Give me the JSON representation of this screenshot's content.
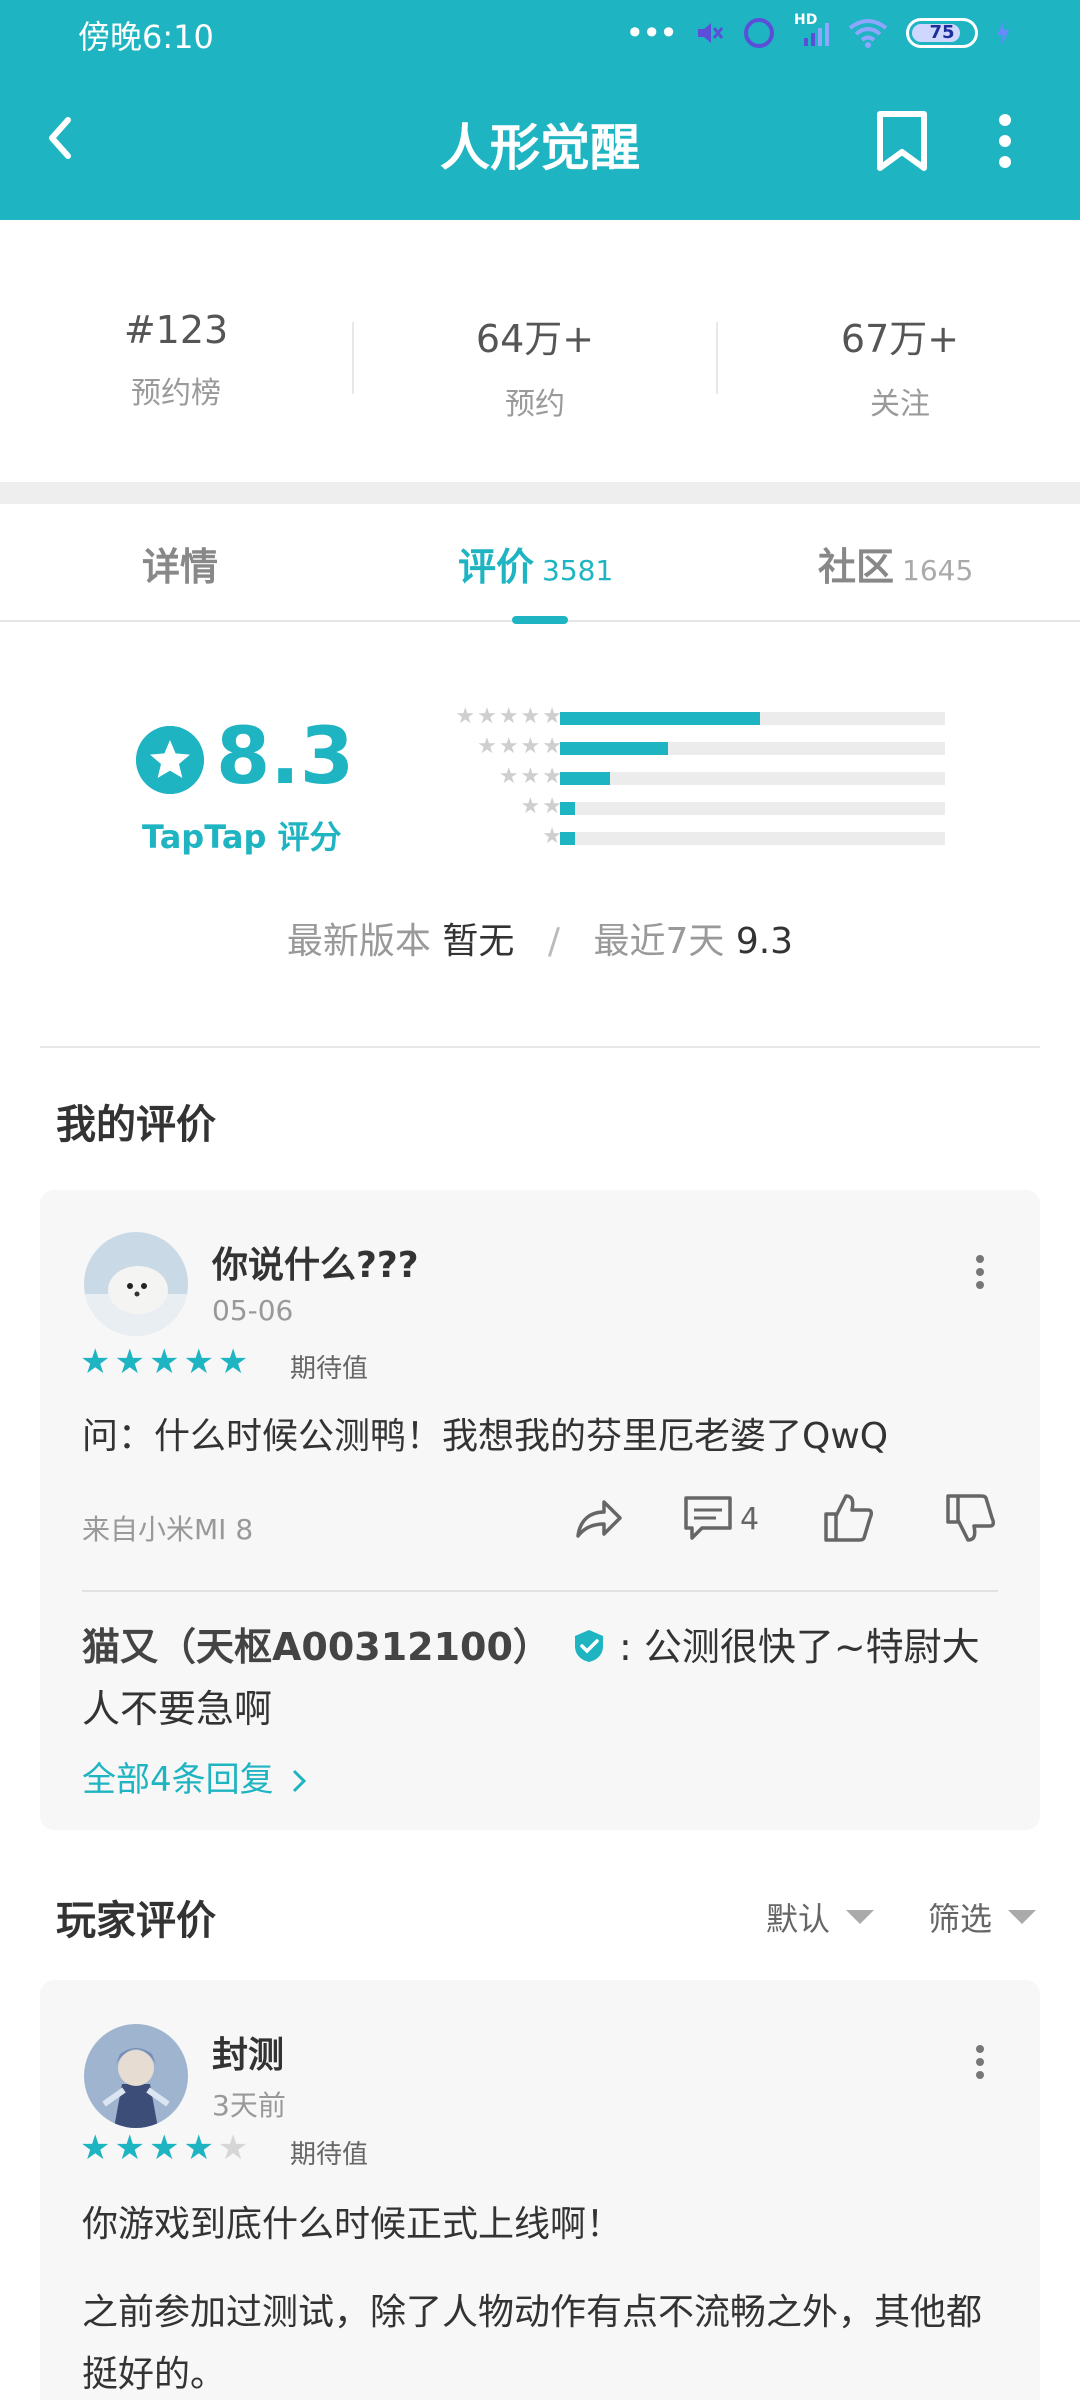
{
  "status_bar": {
    "time": "傍晚6:10",
    "dots": "•••",
    "battery": "75",
    "hd": "HD"
  },
  "header": {
    "title": "人形觉醒"
  },
  "stats": [
    {
      "value": "#123",
      "label": "预约榜"
    },
    {
      "value": "64万+",
      "label": "预约"
    },
    {
      "value": "67万+",
      "label": "关注"
    }
  ],
  "tabs": [
    {
      "label": "详情",
      "count": ""
    },
    {
      "label": "评价",
      "count": "3581"
    },
    {
      "label": "社区",
      "count": "1645"
    }
  ],
  "rating": {
    "score": "8.3",
    "caption": "TapTap 评分",
    "distribution": [
      {
        "stars": 5,
        "fraction": 0.52
      },
      {
        "stars": 4,
        "fraction": 0.28
      },
      {
        "stars": 3,
        "fraction": 0.13
      },
      {
        "stars": 2,
        "fraction": 0.04
      },
      {
        "stars": 1,
        "fraction": 0.04
      }
    ],
    "latest_version_label": "最新版本",
    "latest_version_value": "暂无",
    "separator": "/",
    "recent_label": "最近7天",
    "recent_value": "9.3"
  },
  "my_review": {
    "section_title": "我的评价",
    "user_name": "你说什么???",
    "date": "05-06",
    "stars_filled": 5,
    "stars_label": "期待值",
    "text": "问：什么时候公测鸭！我想我的芬里厄老婆了QwQ",
    "device": "来自小米MI 8",
    "comment_count": "4",
    "reply": {
      "name": "猫又（天枢A00312100）",
      "text": ": 公测很快了~特尉大人不要急啊"
    },
    "more_replies": "全部4条回复"
  },
  "player_reviews": {
    "section_title": "玩家评价",
    "sort_label": "默认",
    "filter_label": "筛选",
    "first": {
      "user_name": "封测",
      "date": "3天前",
      "stars_filled": 4,
      "stars_label": "期待值",
      "text1": "你游戏到底什么时候正式上线啊！",
      "text2": "之前参加过测试，除了人物动作有点不流畅之外，其他都挺好的。"
    }
  }
}
